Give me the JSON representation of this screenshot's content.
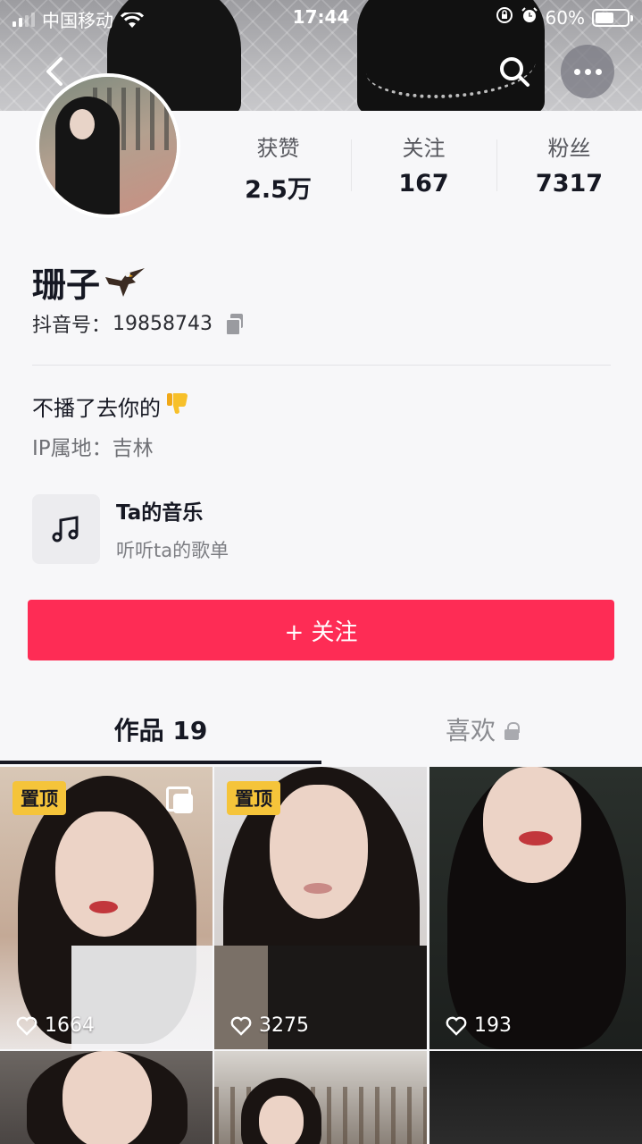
{
  "status_bar": {
    "carrier": "中国移动",
    "time": "17:44",
    "battery": "60%",
    "battery_level": 0.6
  },
  "nav": {
    "back_icon": "chevron-left-icon",
    "search_icon": "search-icon",
    "more_icon": "more-dots-icon"
  },
  "profile": {
    "stats": [
      {
        "label": "获赞",
        "value": "2.5万"
      },
      {
        "label": "关注",
        "value": "167"
      },
      {
        "label": "粉丝",
        "value": "7317"
      }
    ],
    "nickname": "珊子",
    "nickname_emoji": "eagle-icon",
    "douyin_id_label": "抖音号：",
    "douyin_id": "19858743",
    "bio": "不播了去你的",
    "bio_emoji": "thumbs-down-icon",
    "ip_location": "IP属地：吉林"
  },
  "music": {
    "title": "Ta的音乐",
    "subtitle": "听听ta的歌单"
  },
  "follow_button": {
    "label": "+ 关注",
    "color": "#fe2c55"
  },
  "tabs": {
    "works": "作品 19",
    "likes": "喜欢"
  },
  "videos": [
    {
      "pinned": true,
      "pinned_label": "置顶",
      "likes": "1664",
      "multi_image": true
    },
    {
      "pinned": true,
      "pinned_label": "置顶",
      "likes": "3275",
      "multi_image": false
    },
    {
      "pinned": false,
      "likes": "193",
      "multi_image": false
    },
    {
      "pinned": false,
      "likes": "",
      "multi_image": false
    },
    {
      "pinned": false,
      "likes": "",
      "multi_image": false
    },
    {
      "pinned": false,
      "likes": "",
      "multi_image": false
    }
  ]
}
